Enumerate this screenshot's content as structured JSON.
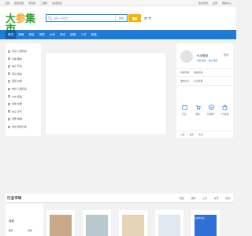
{
  "topbar": {
    "left": [
      "全国",
      "招商加盟",
      "手机版",
      "二维码",
      "在线咨询"
    ],
    "right": [
      "欢迎登录",
      "注册",
      "帮助中心"
    ]
  },
  "logo": {
    "main_a": "大",
    "main_b": "参",
    "main_c": "集市",
    "sub": "DA CAN JI SHI"
  },
  "search": {
    "placeholder": "请输入关键词",
    "scope": "供应",
    "button": "搜索",
    "publish": "发广告"
  },
  "nav": {
    "items": [
      "首页",
      "商城",
      "供应",
      "采购",
      "公司",
      "资讯",
      "招商",
      "人才",
      "知道"
    ],
    "active_index": 0
  },
  "sidebar": {
    "categories": [
      "玩具 儿童玩具",
      "水箱 蓄电",
      "电子 开关",
      "家具 饰品",
      "包装 材质",
      "纺织 儿童玩具",
      "户外 装备",
      "印刷 文娱",
      "电子 天气",
      "家居 电器",
      "综合 其他分类"
    ]
  },
  "user_panel": {
    "greeting": "Hi,请登录",
    "login": "登录",
    "register": "免费注册",
    "find_password": "账户找回",
    "row1": [
      "商铺升级",
      "我的商铺"
    ],
    "row2": [
      "发布信息",
      "信息管理"
    ],
    "services": [
      "供应",
      "求购",
      "分销推广",
      "广告投放"
    ],
    "tabs": [
      "公告",
      "资讯",
      "头条"
    ],
    "active_tab": 0,
    "accent": "#1e7bd6"
  },
  "industry": {
    "title": "行业市场",
    "links": [
      "供应",
      "采购",
      "公司",
      "资讯",
      "招商"
    ],
    "left_heading": "商城",
    "left_a": "推荐",
    "left_b": "采购",
    "promo": "全店满减活动"
  }
}
